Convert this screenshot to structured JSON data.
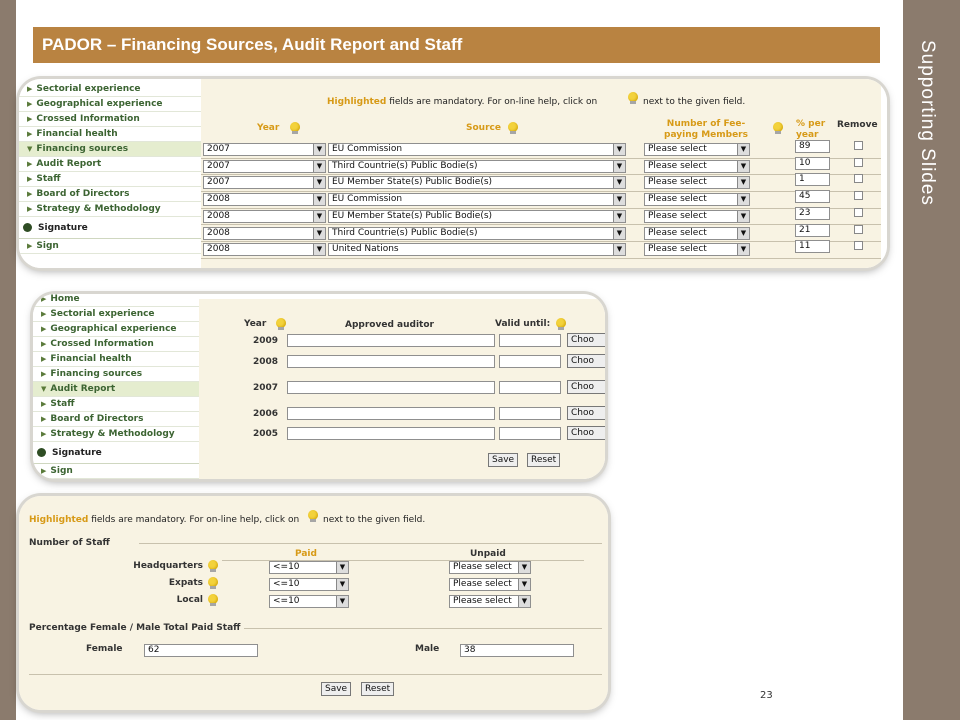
{
  "slide": {
    "title": "PADOR – Financing Sources, Audit Report and Staff",
    "side_title": "Supporting Slides",
    "page_number": "23"
  },
  "nav_financing": [
    {
      "label": "Sectorial experience",
      "selected": false
    },
    {
      "label": "Geographical experience",
      "selected": false
    },
    {
      "label": "Crossed Information",
      "selected": false
    },
    {
      "label": "Financial health",
      "selected": false
    },
    {
      "label": "Financing sources",
      "selected": true
    },
    {
      "label": "Audit Report",
      "selected": false
    },
    {
      "label": "Staff",
      "selected": false
    },
    {
      "label": "Board of Directors",
      "selected": false
    },
    {
      "label": "Strategy & Methodology",
      "selected": false
    }
  ],
  "nav_audit": [
    {
      "label": "Home",
      "selected": false
    },
    {
      "label": "Sectorial experience",
      "selected": false
    },
    {
      "label": "Geographical experience",
      "selected": false
    },
    {
      "label": "Crossed Information",
      "selected": false
    },
    {
      "label": "Financial health",
      "selected": false
    },
    {
      "label": "Financing sources",
      "selected": false
    },
    {
      "label": "Audit Report",
      "selected": true
    },
    {
      "label": "Staff",
      "selected": false
    },
    {
      "label": "Board of Directors",
      "selected": false
    },
    {
      "label": "Strategy & Methodology",
      "selected": false
    }
  ],
  "nav_common": {
    "signature": "Signature",
    "sign": "Sign"
  },
  "financing": {
    "help_highlight": "Highlighted",
    "help_text": "fields are mandatory. For on-line help, click on",
    "help_text2": "next to the given field.",
    "columns": {
      "year": "Year",
      "source": "Source",
      "members": "Number of Fee-paying Members",
      "percent": "% per year",
      "remove": "Remove"
    },
    "rows": [
      {
        "year": "2007",
        "source": "EU Commission",
        "members": "Please select",
        "percent": "89"
      },
      {
        "year": "2007",
        "source": "Third Countrie(s) Public Bodie(s)",
        "members": "Please select",
        "percent": "10"
      },
      {
        "year": "2007",
        "source": "EU Member State(s) Public Bodie(s)",
        "members": "Please select",
        "percent": "1"
      },
      {
        "year": "2008",
        "source": "EU Commission",
        "members": "Please select",
        "percent": "45"
      },
      {
        "year": "2008",
        "source": "EU Member State(s) Public Bodie(s)",
        "members": "Please select",
        "percent": "23"
      },
      {
        "year": "2008",
        "source": "Third Countrie(s) Public Bodie(s)",
        "members": "Please select",
        "percent": "21"
      },
      {
        "year": "2008",
        "source": "United Nations",
        "members": "Please select",
        "percent": "11"
      }
    ]
  },
  "audit": {
    "columns": {
      "year": "Year",
      "auditor": "Approved auditor",
      "valid": "Valid until:"
    },
    "rows": [
      {
        "year": "2009",
        "choose": "Choo"
      },
      {
        "year": "2008",
        "choose": "Choo"
      },
      {
        "year": "2007",
        "choose": "Choo"
      },
      {
        "year": "2006",
        "choose": "Choo"
      },
      {
        "year": "2005",
        "choose": "Choo"
      }
    ],
    "save": "Save",
    "reset": "Reset"
  },
  "staff": {
    "help_highlight": "Highlighted",
    "help_text": "fields are mandatory. For on-line help, click on",
    "help_text2": "next to the given field.",
    "section_staff": "Number of Staff",
    "col_paid": "Paid",
    "col_unpaid": "Unpaid",
    "rows": [
      {
        "label": "Headquarters",
        "paid": "<=10",
        "unpaid": "Please select"
      },
      {
        "label": "Expats",
        "paid": "<=10",
        "unpaid": "Please select"
      },
      {
        "label": "Local",
        "paid": "<=10",
        "unpaid": "Please select"
      }
    ],
    "section_pct": "Percentage Female / Male Total Paid Staff",
    "female_label": "Female",
    "female_value": "62",
    "male_label": "Male",
    "male_value": "38",
    "save": "Save",
    "reset": "Reset"
  },
  "colors": {
    "title_bar": "#b98341",
    "frame": "#8b7b6d",
    "mandatory": "#d79a17",
    "nav_text": "#3c6432",
    "form_bg": "#f8f3e3"
  }
}
